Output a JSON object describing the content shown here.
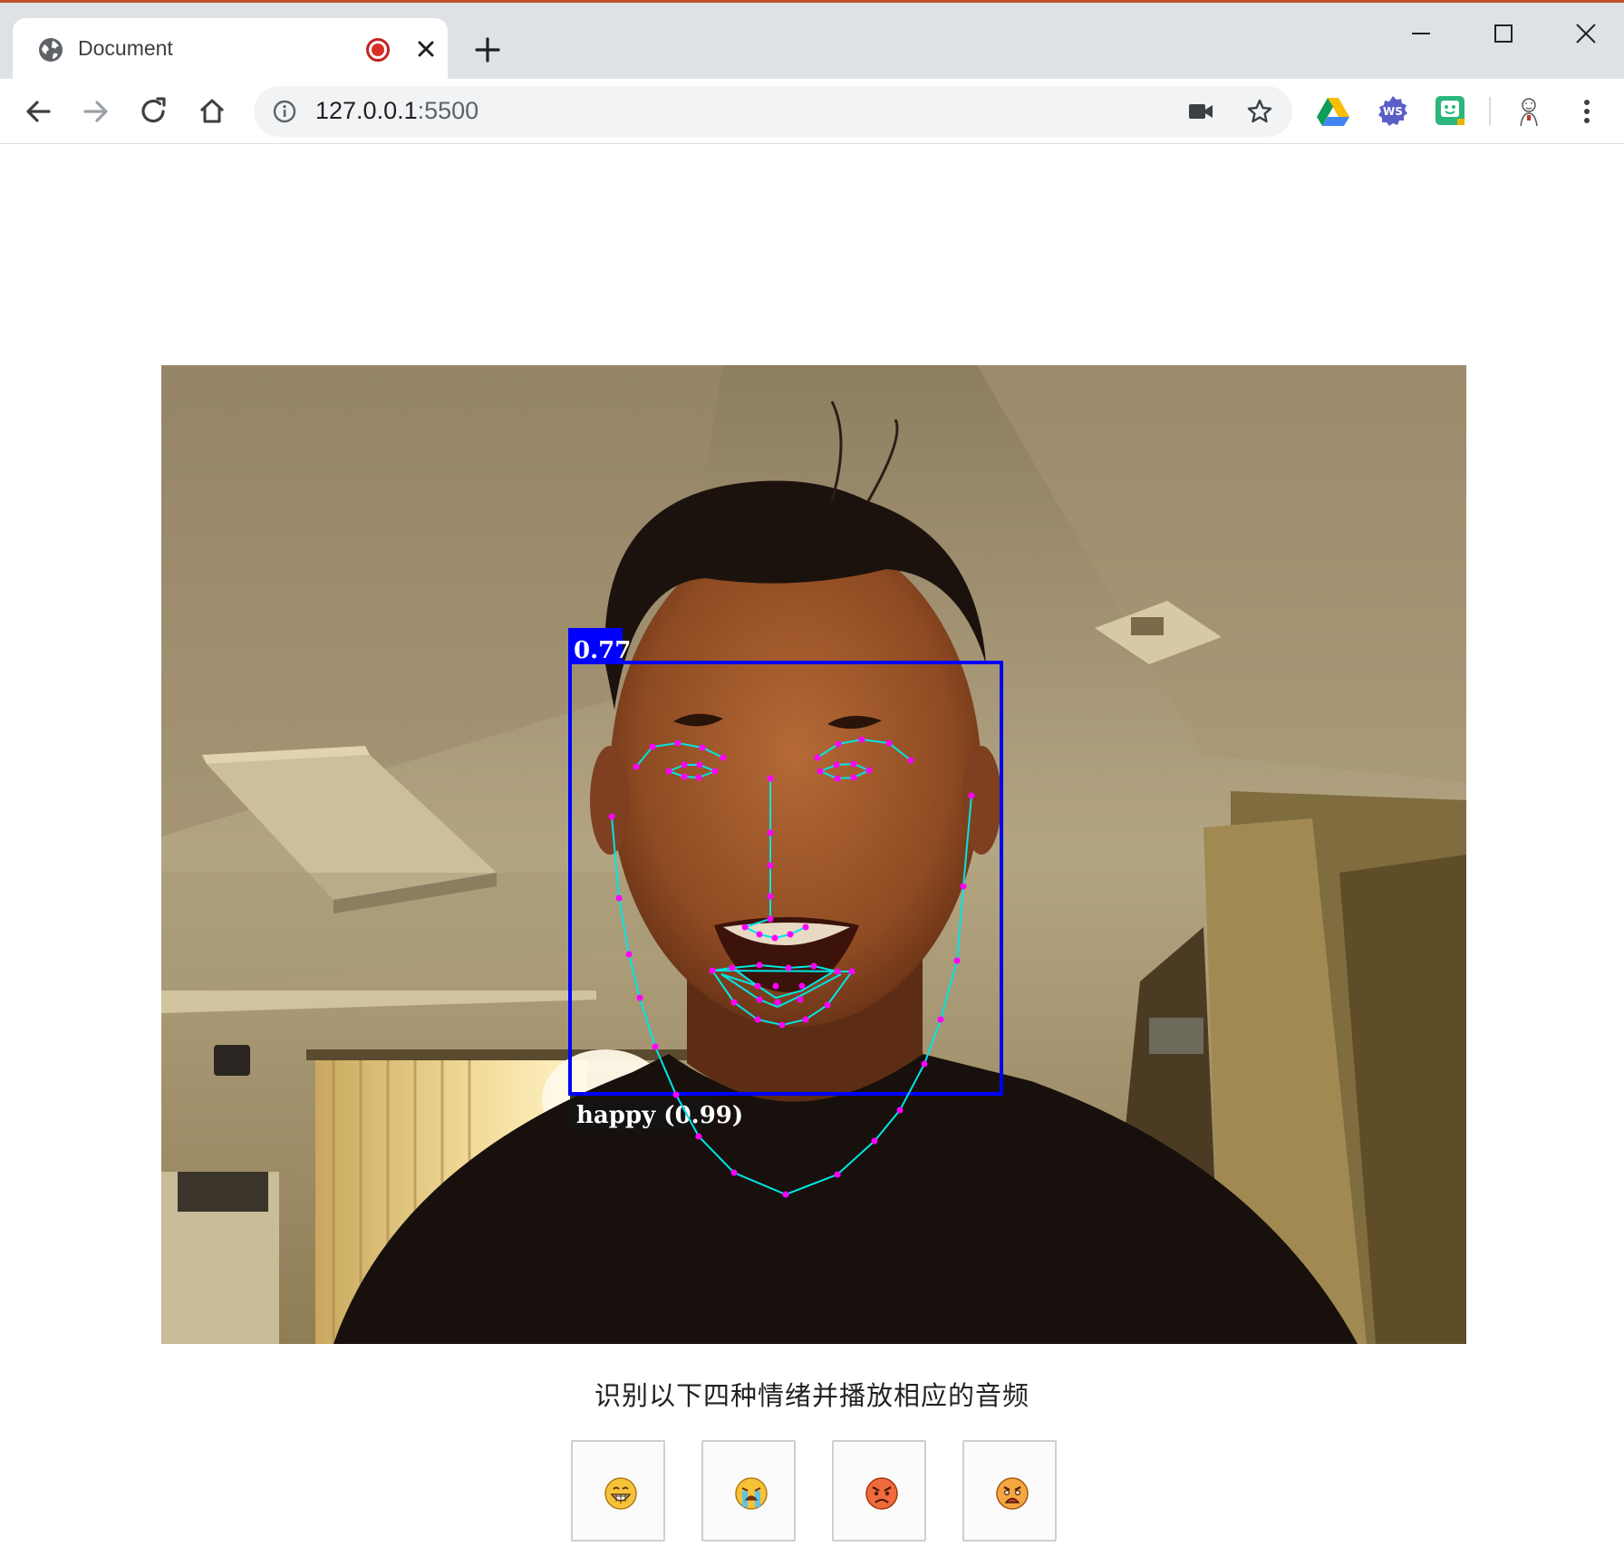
{
  "browser": {
    "tab_title": "Document",
    "url_host": "127.0.0.1",
    "url_port": ":5500"
  },
  "detection": {
    "box_score": "0.77",
    "expression_label": "happy (0.99)",
    "box_color": "#0000ff",
    "landmark_line_color": "#00e5e5",
    "landmark_point_color": "#ff00ff"
  },
  "content": {
    "caption": "识别以下四种情绪并播放相应的音频",
    "emotion_buttons": [
      {
        "icon": "grinning-face-icon"
      },
      {
        "icon": "crying-face-icon"
      },
      {
        "icon": "angry-face-icon"
      },
      {
        "icon": "upset-face-icon"
      }
    ]
  }
}
